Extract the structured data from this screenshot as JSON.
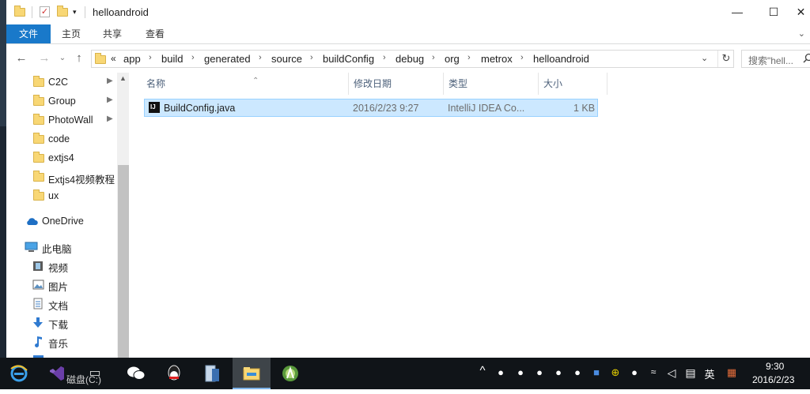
{
  "titlebar": {
    "title": "helloandroid",
    "minimize": "—",
    "maximize": "☐",
    "close": "✕"
  },
  "ribbon": {
    "tabs": [
      "文件",
      "主页",
      "共享",
      "查看"
    ],
    "expand": "⌄"
  },
  "nav": {
    "back": "←",
    "forward": "→",
    "recent": "⌄",
    "up": "↑"
  },
  "address": {
    "overflow": "«",
    "crumbs": [
      "app",
      "build",
      "generated",
      "source",
      "buildConfig",
      "debug",
      "org",
      "metrox",
      "helloandroid"
    ],
    "separator": "›",
    "dropdown": "⌄",
    "refresh": "↻"
  },
  "search": {
    "placeholder": "搜索\"hell...",
    "icon": "search-icon"
  },
  "navpane": {
    "quick_access": [
      {
        "label": "C2C",
        "pinned": true
      },
      {
        "label": "Group",
        "pinned": true
      },
      {
        "label": "PhotoWall",
        "pinned": true
      },
      {
        "label": "code",
        "pinned": false
      },
      {
        "label": "extjs4",
        "pinned": false
      },
      {
        "label": "Extjs4视频教程",
        "pinned": false
      },
      {
        "label": "ux",
        "pinned": false
      }
    ],
    "onedrive": "OneDrive",
    "this_pc": "此电脑",
    "pc_items": [
      "视频",
      "图片",
      "文档",
      "下载",
      "音乐",
      "桌面"
    ],
    "pin_glyph": "📌",
    "scroll_up": "▲"
  },
  "columns": {
    "name": "名称",
    "date": "修改日期",
    "type": "类型",
    "size": "大小",
    "sort_arrow": "⌃"
  },
  "files": [
    {
      "name": "BuildConfig.java",
      "date": "2016/2/23 9:27",
      "type": "IntelliJ IDEA Co...",
      "size": "1 KB",
      "selected": true,
      "icon_text": "IJ"
    }
  ],
  "taskbar": {
    "apps": [
      "ie-icon",
      "visual-studio-icon",
      "terminal-icon",
      "wechat-icon",
      "qq-icon",
      "server-manager-icon",
      "file-explorer-icon",
      "android-studio-icon"
    ],
    "overlap_text": "磁盘(C:)",
    "tray_ime": "英",
    "time": "9:30",
    "date": "2016/2/23"
  }
}
